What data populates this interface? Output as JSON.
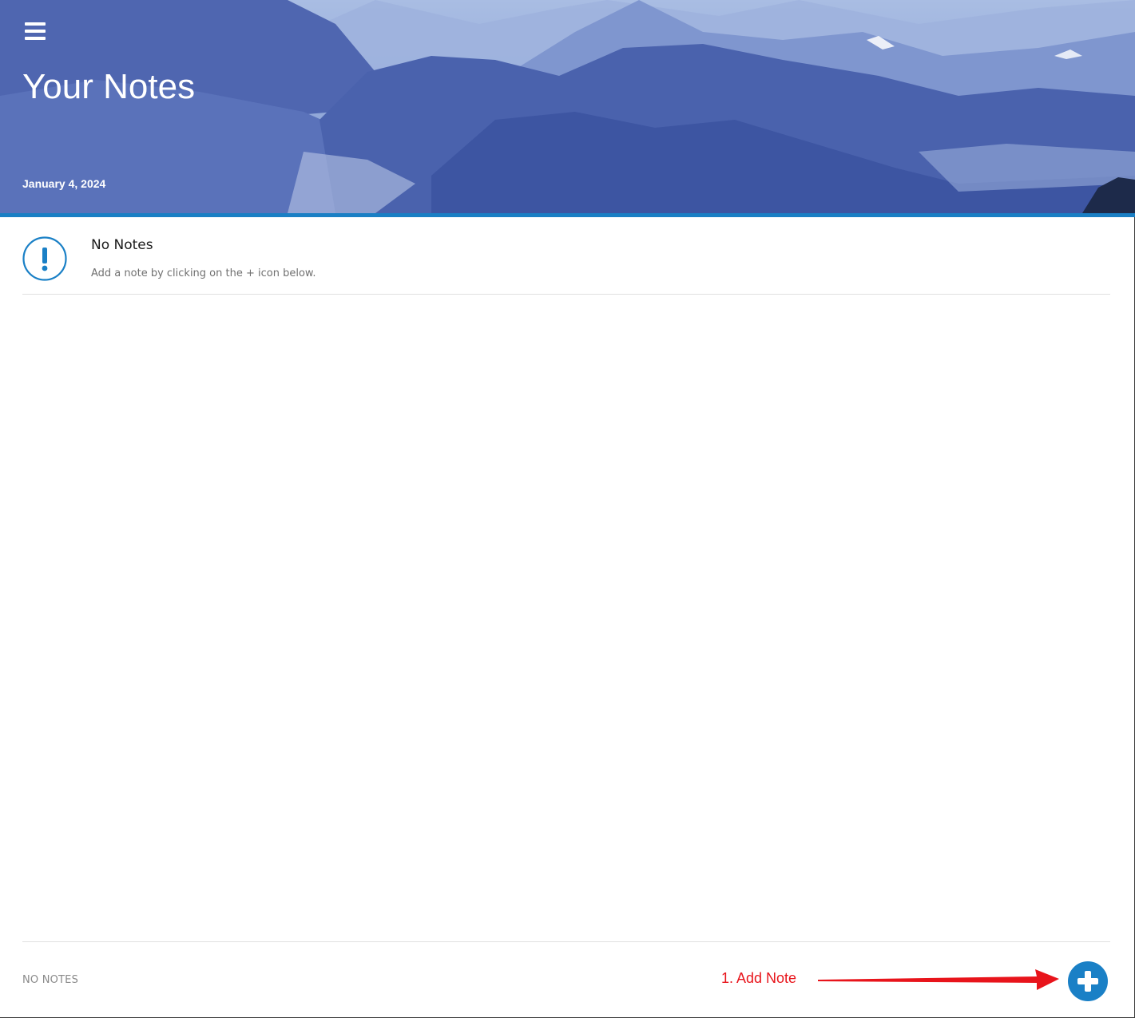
{
  "header": {
    "title": "Your Notes",
    "date": "January 4, 2024",
    "menu_icon": "hamburger-menu-icon"
  },
  "empty_state": {
    "icon": "exclamation-circle-icon",
    "title": "No Notes",
    "subtitle": "Add a note by clicking on the + icon below."
  },
  "footer": {
    "count_label": "NO NOTES",
    "add_icon": "plus-icon"
  },
  "annotation": {
    "label": "1. Add Note",
    "color": "#e8141b"
  },
  "colors": {
    "accent": "#1a80c6",
    "stripe": "#1a7fc4"
  }
}
